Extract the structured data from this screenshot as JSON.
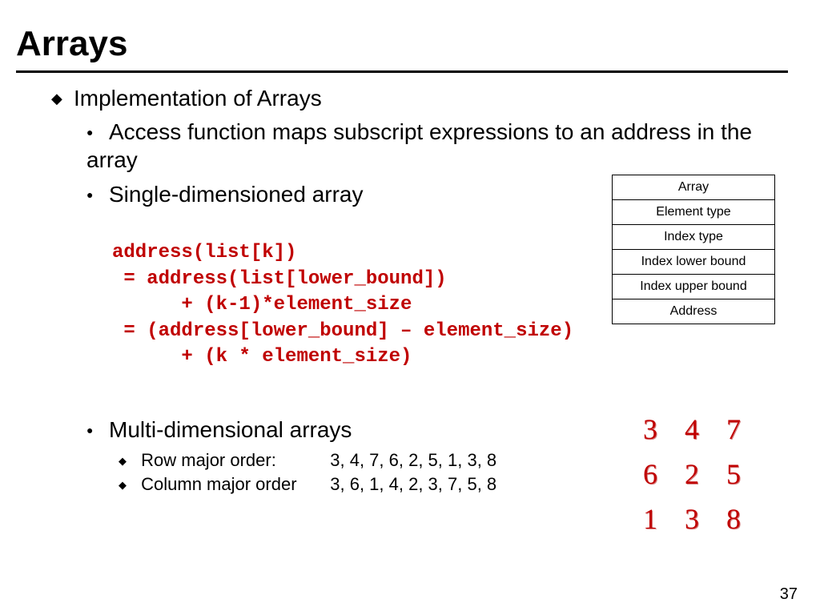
{
  "title": "Arrays",
  "heading": "Implementation of Arrays",
  "bullets": {
    "access": "Access function maps subscript expressions to an address in the array",
    "single": "Single-dimensioned array",
    "multi": "Multi-dimensional arrays",
    "rowmajor_label": "Row major order:",
    "rowmajor_vals": "3, 4, 7, 6, 2, 5, 1, 3, 8",
    "colmajor_label": "Column major order",
    "colmajor_vals": "3, 6, 1, 4, 2, 3, 7, 5, 8"
  },
  "code_lines": {
    "l1": "address(list[k])",
    "l2": " = address(list[lower_bound])",
    "l3": "      + (k-1)*element_size",
    "l4": " = (address[lower_bound] – element_size)",
    "l5": "      + (k * element_size)"
  },
  "descriptor": {
    "r0": "Array",
    "r1": "Element type",
    "r2": "Index type",
    "r3": "Index lower bound",
    "r4": "Index upper bound",
    "r5": "Address"
  },
  "matrix": {
    "r0c0": "3",
    "r0c1": "4",
    "r0c2": "7",
    "r1c0": "6",
    "r1c1": "2",
    "r1c2": "5",
    "r2c0": "1",
    "r2c1": "3",
    "r2c2": "8"
  },
  "page_number": "37"
}
